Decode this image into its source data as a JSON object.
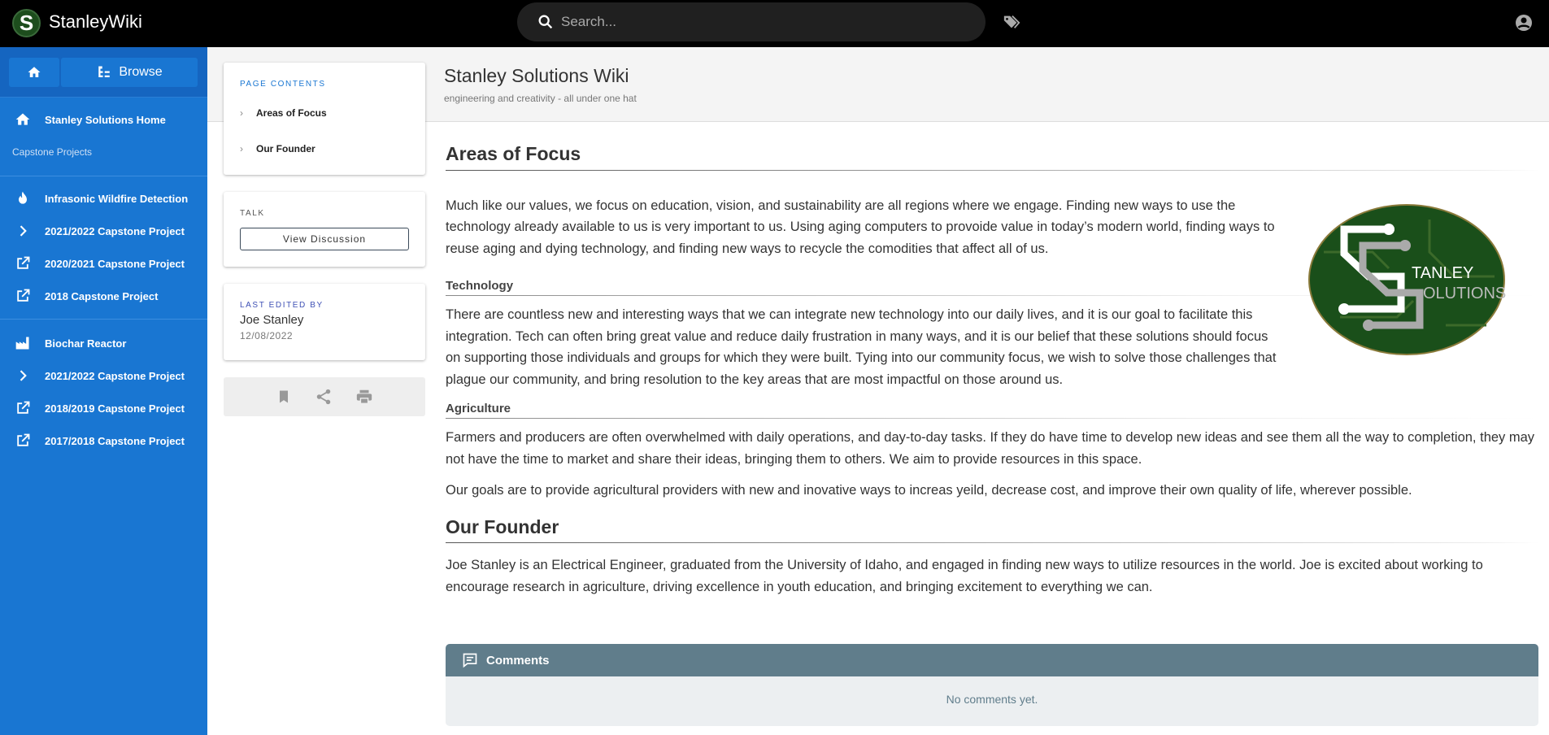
{
  "header": {
    "app_title": "StanleyWiki",
    "logo_letter": "S",
    "search_placeholder": "Search..."
  },
  "sidebar": {
    "browse_label": "Browse",
    "home_item": "Stanley Solutions Home",
    "section_label": "Capstone Projects",
    "groups": [
      {
        "title": "Infrasonic Wildfire Detection",
        "icon": "fire-icon",
        "items": [
          {
            "label": "2021/2022 Capstone Project",
            "icon": "chevron-right-icon"
          },
          {
            "label": "2020/2021 Capstone Project",
            "icon": "open-in-new-icon"
          },
          {
            "label": "2018 Capstone Project",
            "icon": "open-in-new-icon"
          }
        ]
      },
      {
        "title": "Biochar Reactor",
        "icon": "factory-icon",
        "items": [
          {
            "label": "2021/2022 Capstone Project",
            "icon": "chevron-right-icon"
          },
          {
            "label": "2018/2019 Capstone Project",
            "icon": "open-in-new-icon"
          },
          {
            "label": "2017/2018 Capstone Project",
            "icon": "open-in-new-icon"
          }
        ]
      }
    ]
  },
  "toc": {
    "caption": "PAGE CONTENTS",
    "items": [
      "Areas of Focus",
      "Our Founder"
    ]
  },
  "talk": {
    "caption": "TALK",
    "button": "View Discussion"
  },
  "edited": {
    "caption": "LAST EDITED BY",
    "name": "Joe Stanley",
    "date": "12/08/2022"
  },
  "page": {
    "title": "Stanley Solutions Wiki",
    "subtitle": "engineering and creativity - all under one hat"
  },
  "emblem": {
    "line1": "TANLEY",
    "line2": "OLUTIONS"
  },
  "content": {
    "h_focus": "Areas of Focus",
    "p_focus": "Much like our values, we focus on education, vision, and sustainability are all regions where we engage. Finding new ways to use the technology already available to us is very important to us. Using aging computers to provoide value in today’s modern world, finding ways to reuse aging and dying technology, and finding new ways to recycle the comodities that affect all of us.",
    "h_tech": "Technology",
    "p_tech": "There are countless new and interesting ways that we can integrate new technology into our daily lives, and it is our goal to facilitate this integration. Tech can often bring great value and reduce daily frustration in many ways, and it is our belief that these solutions should focus on supporting those individuals and groups for which they were built. Tying into our community focus, we wish to solve those challenges that plague our community, and bring resolution to the key areas that are most impactful on those around us.",
    "h_ag": "Agriculture",
    "p_ag1": "Farmers and producers are often overwhelmed with daily operations, and day-to-day tasks. If they do have time to develop new ideas and see them all the way to completion, they may not have the time to market and share their ideas, bringing them to others. We aim to provide resources in this space.",
    "p_ag2": "Our goals are to provide agricultural providers with new and inovative ways to increas yeild, decrease cost, and improve their own quality of life, wherever possible.",
    "h_founder": "Our Founder",
    "p_founder": "Joe Stanley is an Electrical Engineer, graduated from the University of Idaho, and engaged in finding new ways to utilize resources in the world. Joe is excited about working to encourage research in agriculture, driving excellence in youth education, and bringing excitement to everything we can."
  },
  "comments": {
    "title": "Comments",
    "empty": "No comments yet."
  },
  "colors": {
    "sidebar": "#1976d2",
    "comments_header": "#607d8b"
  }
}
